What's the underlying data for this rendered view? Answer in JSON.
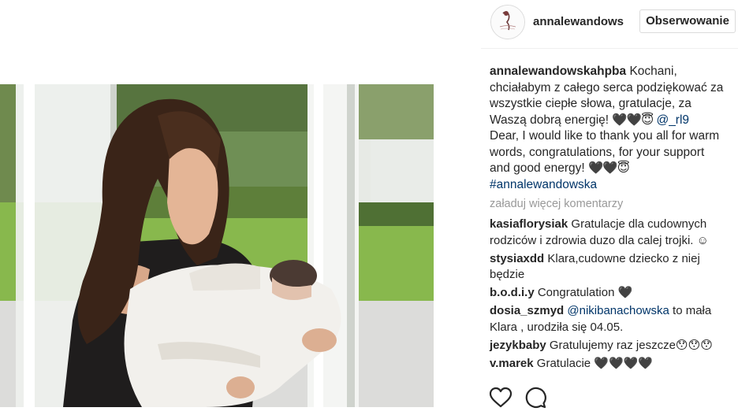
{
  "post": {
    "author": {
      "username": "annalewandowsl",
      "follow_label": "Obserwowanie"
    },
    "caption": {
      "username": "annalewandowskahpba",
      "text_pl": " Kochani, chciałabym z całego serca podziękować za wszystkie ciepłe słowa, gratulacje, za Waszą dobrą energię! ",
      "emoji_1": "🖤🖤😇",
      "mention": "@_rl9",
      "text_en": "Dear, I would like to thank you all for warm words, congratulations, for your support and good energy! ",
      "emoji_2": "🖤🖤😇",
      "hashtag": "#annalewandowska"
    },
    "load_more_label": "załaduj więcej komentarzy",
    "comments": [
      {
        "user": "kasiaflorysiak",
        "text": " Gratulacje dla cudownych rodziców i zdrowia duzo dla calej trojki. ☺"
      },
      {
        "user": "stysiaxdd",
        "text": " Klara,cudowne dziecko z niej będzie"
      },
      {
        "user": "b.o.d.i.y",
        "text": " Congratulation 🖤"
      },
      {
        "user": "dosia_szmyd",
        "mention": "@nikibanachowska",
        "text": " to mała Klara , urodziła się 04.05."
      },
      {
        "user": "jezykbaby",
        "text": " Gratulujemy raz jeszcze😯😯😯"
      },
      {
        "user": "v.marek",
        "text": " Gratulacie 🖤🖤🖤🖤"
      }
    ],
    "actions": {
      "like_icon": "heart-outline-icon",
      "comment_icon": "speech-bubble-icon"
    },
    "colors": {
      "link": "#003569",
      "muted": "#999999",
      "text": "#262626",
      "border": "#dbdbdb"
    }
  }
}
